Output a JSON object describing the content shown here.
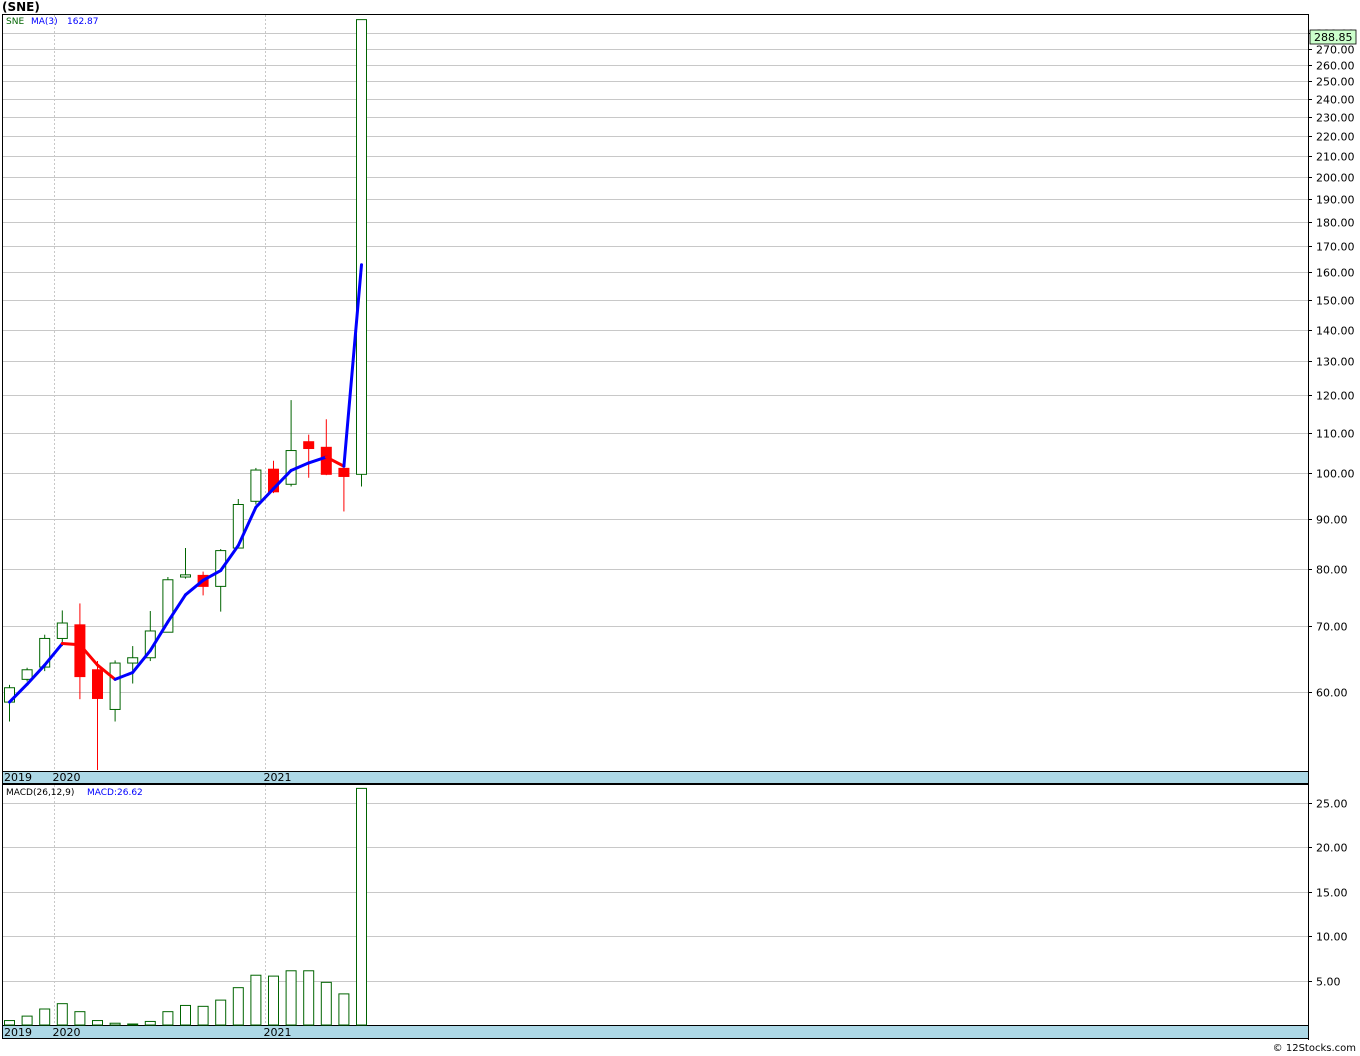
{
  "title": "(SNE)",
  "credit": "© 12Stocks.com",
  "colors": {
    "up_candle": "#006400",
    "down_candle": "#ff0000",
    "ma_up": "#0000ff",
    "ma_down": "#ff0000",
    "macd_bar": "#006400",
    "grid": "#c8c8c8",
    "date_strip": "#add8e6",
    "last_price_box": "#ccffcc"
  },
  "chart_data": [
    {
      "type": "candlestick",
      "symbol_label": "SNE",
      "indicator_label": "MA(3)",
      "indicator_value": "162.87",
      "y_scale": "log",
      "ylim": [
        50,
        292
      ],
      "y_ticks": [
        60,
        70,
        80,
        90,
        100,
        110,
        120,
        130,
        140,
        150,
        160,
        170,
        180,
        190,
        200,
        210,
        220,
        230,
        240,
        250,
        260,
        270,
        280
      ],
      "x_tick_labels": [
        "2019",
        "2020",
        "2021"
      ],
      "x_tick_positions": [
        0,
        3,
        15
      ],
      "last_price": "288.85",
      "candles": [
        {
          "o": 58.6,
          "h": 61.0,
          "l": 56.0,
          "c": 60.6
        },
        {
          "o": 61.8,
          "h": 63.5,
          "l": 61.5,
          "c": 63.2
        },
        {
          "o": 63.6,
          "h": 68.6,
          "l": 63.0,
          "c": 68.0
        },
        {
          "o": 68.0,
          "h": 72.6,
          "l": 66.8,
          "c": 70.5
        },
        {
          "o": 70.2,
          "h": 73.8,
          "l": 59.0,
          "c": 62.2
        },
        {
          "o": 63.2,
          "h": 64.5,
          "l": 50.0,
          "c": 59.1
        },
        {
          "o": 57.6,
          "h": 64.6,
          "l": 56.0,
          "c": 64.2
        },
        {
          "o": 64.2,
          "h": 66.8,
          "l": 61.2,
          "c": 65.0
        },
        {
          "o": 65.0,
          "h": 72.5,
          "l": 64.5,
          "c": 69.2
        },
        {
          "o": 69.0,
          "h": 78.5,
          "l": 69.0,
          "c": 78.0
        },
        {
          "o": 78.5,
          "h": 84.0,
          "l": 78.2,
          "c": 78.9
        },
        {
          "o": 78.8,
          "h": 79.5,
          "l": 75.2,
          "c": 76.8
        },
        {
          "o": 76.8,
          "h": 83.8,
          "l": 72.4,
          "c": 83.5
        },
        {
          "o": 84.0,
          "h": 94.2,
          "l": 84.0,
          "c": 93.0
        },
        {
          "o": 93.7,
          "h": 101.3,
          "l": 93.0,
          "c": 100.8
        },
        {
          "o": 101.0,
          "h": 103.0,
          "l": 95.5,
          "c": 95.8
        },
        {
          "o": 97.5,
          "h": 118.7,
          "l": 97.0,
          "c": 105.5
        },
        {
          "o": 107.7,
          "h": 109.5,
          "l": 99.0,
          "c": 106.0
        },
        {
          "o": 106.3,
          "h": 113.5,
          "l": 99.6,
          "c": 99.8
        },
        {
          "o": 101.2,
          "h": 101.3,
          "l": 91.5,
          "c": 99.3
        },
        {
          "o": 99.8,
          "h": 288.85,
          "l": 97.0,
          "c": 288.85
        }
      ],
      "ma3": [
        58.6,
        61.1,
        63.9,
        67.2,
        67.0,
        63.9,
        61.8,
        62.8,
        66.1,
        70.7,
        75.3,
        77.9,
        79.7,
        84.5,
        92.4,
        96.5,
        100.7,
        102.5,
        103.9,
        101.7,
        162.87
      ]
    },
    {
      "type": "bar",
      "indicator_label": "MACD(26,12,9)",
      "value_label": "MACD:26.62",
      "ylim": [
        0,
        27
      ],
      "y_ticks": [
        5,
        10,
        15,
        20,
        25
      ],
      "x_tick_labels": [
        "2019",
        "2020",
        "2021"
      ],
      "values": [
        0.5,
        1.0,
        1.8,
        2.4,
        1.5,
        0.5,
        0.2,
        0.0,
        0.4,
        1.5,
        2.2,
        2.1,
        2.8,
        4.2,
        5.6,
        5.5,
        6.1,
        6.1,
        4.8,
        3.5,
        26.62
      ]
    }
  ]
}
